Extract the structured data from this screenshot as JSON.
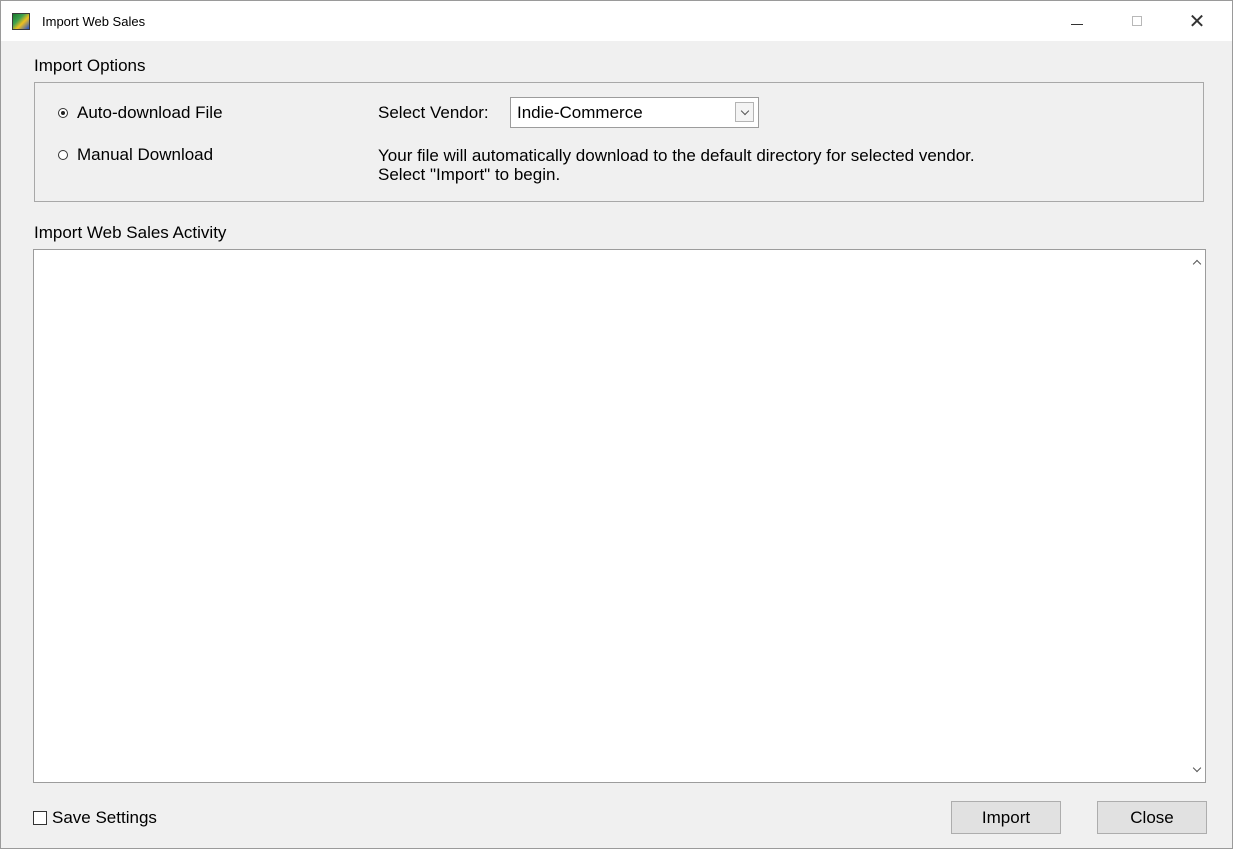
{
  "window": {
    "title": "Import Web Sales"
  },
  "options": {
    "group_label": "Import Options",
    "radio_auto_label": "Auto-download File",
    "radio_auto_selected": true,
    "radio_manual_label": "Manual Download",
    "radio_manual_selected": false,
    "vendor_label": "Select Vendor:",
    "vendor_selected": "Indie-Commerce",
    "info_line_1": "Your file will automatically download to the default directory for selected vendor.",
    "info_line_2": "Select \"Import\" to begin."
  },
  "activity": {
    "group_label": "Import Web Sales Activity",
    "content": ""
  },
  "footer": {
    "save_settings_label": "Save Settings",
    "save_settings_checked": false,
    "import_label": "Import",
    "close_label": "Close"
  },
  "icons": {
    "app": "app-icon",
    "minimize": "minimize-icon",
    "maximize": "maximize-icon",
    "close": "close-icon",
    "dropdown": "chevron-down-icon",
    "scroll_up": "chevron-up-icon",
    "scroll_down": "chevron-down-icon"
  },
  "colors": {
    "window_bg": "#f0f0f0",
    "titlebar_bg": "#ffffff",
    "button_bg": "#e1e1e1",
    "border": "#a8a8a8"
  }
}
